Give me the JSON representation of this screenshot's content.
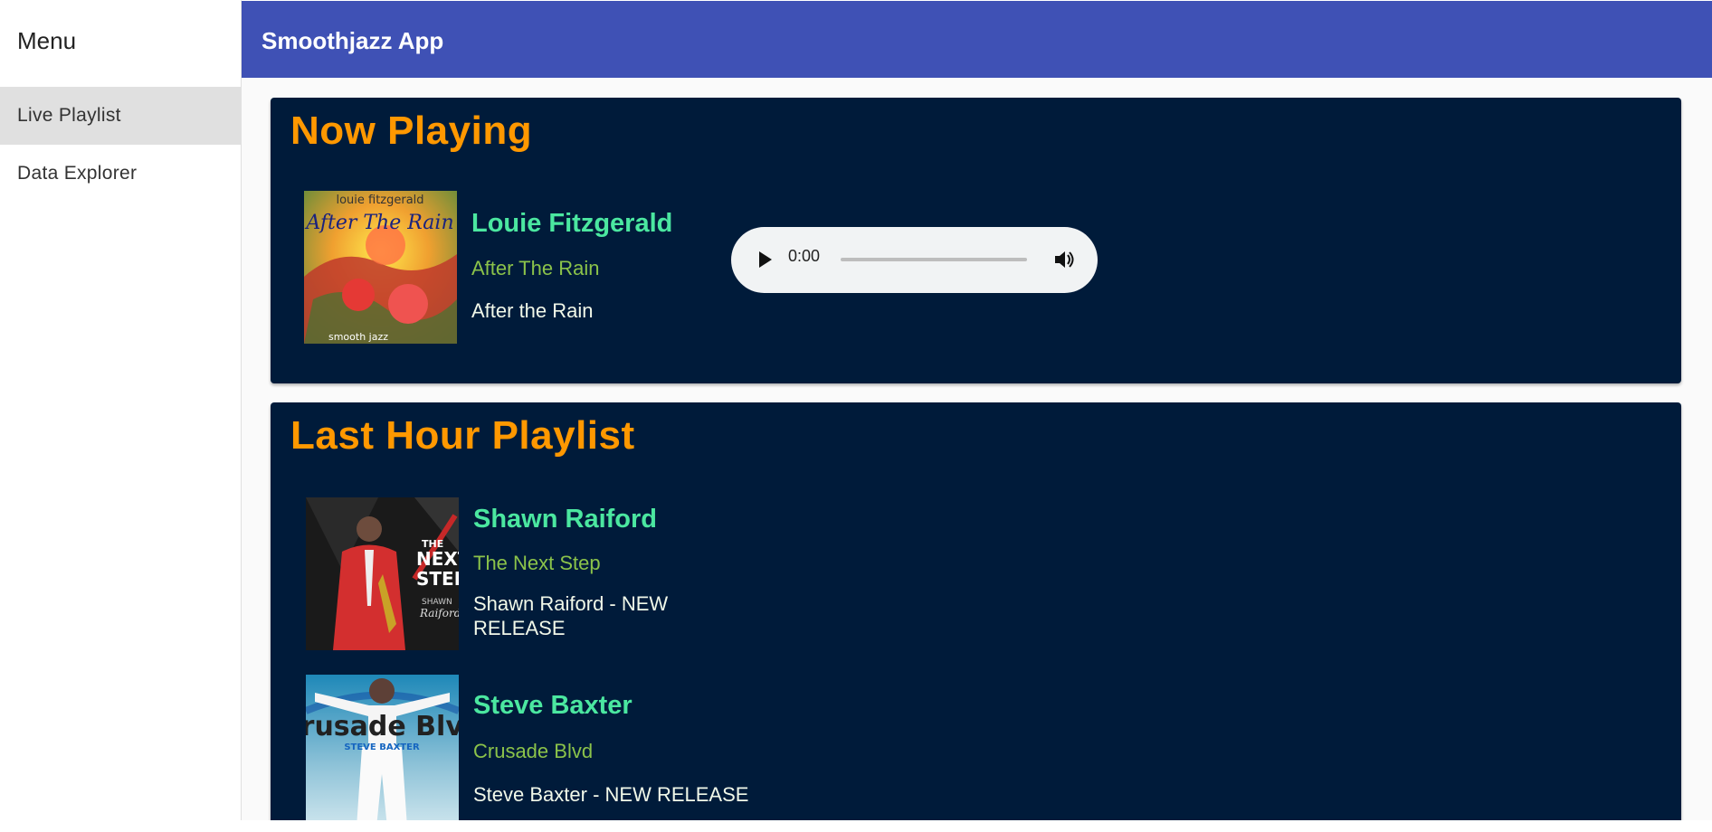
{
  "sidebar": {
    "title": "Menu",
    "items": [
      {
        "label": "Live Playlist",
        "active": true
      },
      {
        "label": "Data Explorer",
        "active": false
      }
    ]
  },
  "appbar": {
    "title": "Smoothjazz App",
    "color": "#3f51b5"
  },
  "now_playing": {
    "heading": "Now Playing",
    "artist": "Louie Fitzgerald",
    "album": "After The Rain",
    "song": "After the Rain",
    "audio": {
      "time": "0:00",
      "play_icon": "play-icon",
      "volume_icon": "volume-icon"
    }
  },
  "last_hour": {
    "heading": "Last Hour Playlist",
    "tracks": [
      {
        "artist": "Shawn Raiford",
        "album": "The Next Step",
        "song": "Shawn Raiford - NEW RELEASE"
      },
      {
        "artist": "Steve Baxter",
        "album": "Crusade Blvd",
        "song": "Steve Baxter - NEW RELEASE"
      }
    ]
  },
  "colors": {
    "card_bg": "#001b3a",
    "heading": "#ff9800",
    "artist": "#4be7a0",
    "album": "#8bc34a",
    "song": "#f1f8e9"
  }
}
